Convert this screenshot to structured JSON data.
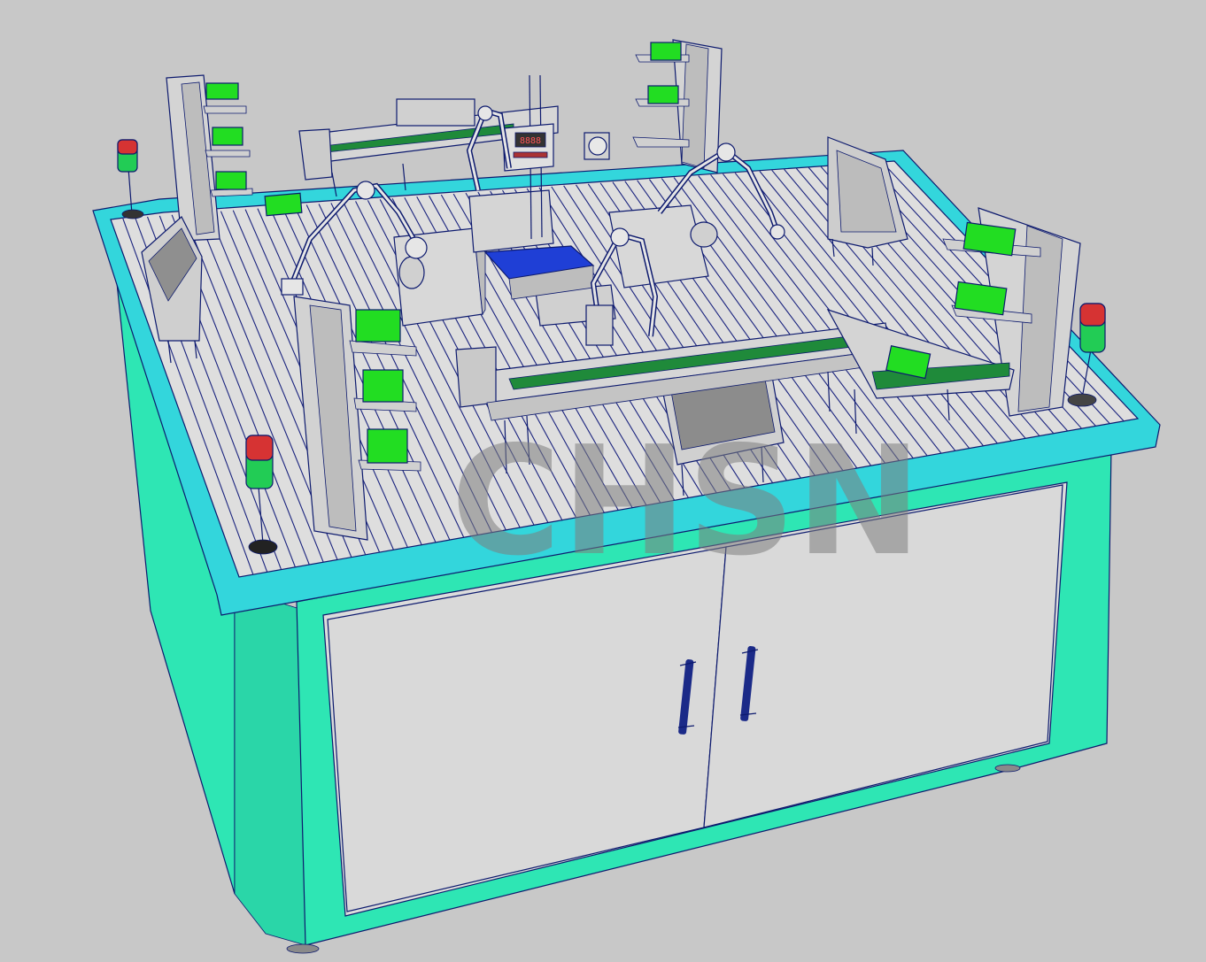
{
  "watermark": {
    "text": "CHSN"
  },
  "scale_display": {
    "readout": "8888"
  },
  "colors": {
    "background": "#c8c8c8",
    "cabinet_teal": "#2ee6b4",
    "table_rim_cyan": "#33d6dc",
    "panel_grey": "#d9d9d9",
    "tray_green": "#22dd22",
    "belt_green": "#1f8a3a",
    "wire_blue": "#0d1a6e",
    "platform_blue": "#1f3fd6",
    "watermark_red": "#d64040",
    "watermark_grey": "#7d7d7d"
  },
  "icons": [
    "signal-tower-icon",
    "robot-arm-icon",
    "conveyor-icon",
    "storage-rack-icon",
    "hmi-screen-icon",
    "door-handle-icon"
  ]
}
